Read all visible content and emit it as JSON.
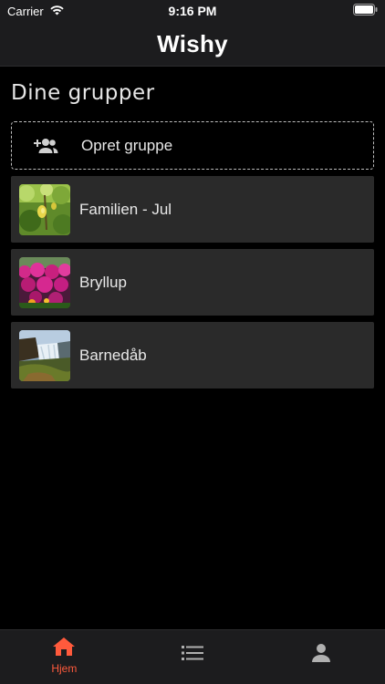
{
  "status_bar": {
    "carrier": "Carrier",
    "time": "9:16 PM"
  },
  "nav": {
    "title": "Wishy"
  },
  "main": {
    "section_title": "Dine grupper",
    "create_group_label": "Opret gruppe",
    "groups": [
      {
        "name": "Familien - Jul",
        "thumbnail": "lemon-tree-photo"
      },
      {
        "name": "Bryllup",
        "thumbnail": "pink-flowers-photo"
      },
      {
        "name": "Barnedåb",
        "thumbnail": "waterfall-photo"
      }
    ]
  },
  "tab_bar": {
    "active_color": "#ff5a3c",
    "inactive_color": "#b0b0b0",
    "tabs": [
      {
        "label": "Hjem",
        "icon": "home-icon",
        "active": true
      },
      {
        "label": "",
        "icon": "list-icon",
        "active": false
      },
      {
        "label": "",
        "icon": "person-icon",
        "active": false
      }
    ]
  }
}
